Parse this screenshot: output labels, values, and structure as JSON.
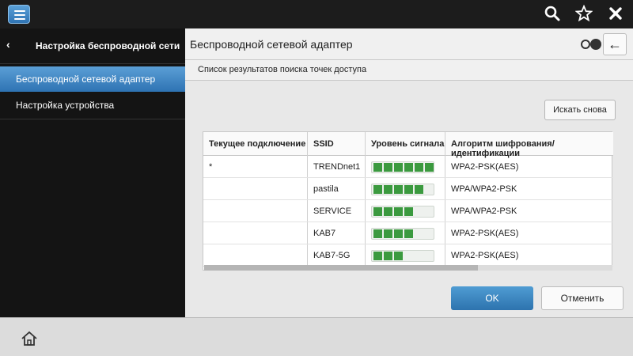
{
  "topbar": {
    "icons": [
      "menu-icon",
      "search-icon",
      "star-icon",
      "close-icon"
    ]
  },
  "sidebar": {
    "title": "Настройка беспроводной сети",
    "back_glyph": "‹",
    "items": [
      {
        "label": "Беспроводной сетевой адаптер"
      },
      {
        "label": "Настройка устройства"
      }
    ]
  },
  "main": {
    "title": "Беспроводной сетевой адаптер",
    "subtitle": "Список результатов поиска точек доступа",
    "search_again": "Искать снова",
    "table": {
      "headers": [
        "Текущее подключение",
        "SSID",
        "Уровень сигнала",
        "Алгоритм шифрования/идентификации"
      ],
      "rows": [
        {
          "current": "*",
          "ssid": "TRENDnet1",
          "signal": 6,
          "encryption": "WPA2-PSK(AES)"
        },
        {
          "current": "",
          "ssid": "pastila",
          "signal": 5,
          "encryption": "WPA/WPA2-PSK"
        },
        {
          "current": "",
          "ssid": "SERVICE",
          "signal": 4,
          "encryption": "WPA/WPA2-PSK"
        },
        {
          "current": "",
          "ssid": "KAB7",
          "signal": 4,
          "encryption": "WPA2-PSK(AES)"
        },
        {
          "current": "",
          "ssid": "KAB7-5G",
          "signal": 3,
          "encryption": "WPA2-PSK(AES)"
        }
      ],
      "signal_max": 6,
      "signal_color": "#3b9a3f"
    },
    "ok": "OK",
    "cancel": "Отменить"
  },
  "bottombar": {
    "icons": [
      "home-icon"
    ]
  },
  "colors": {
    "accent": "#2e73b3"
  }
}
